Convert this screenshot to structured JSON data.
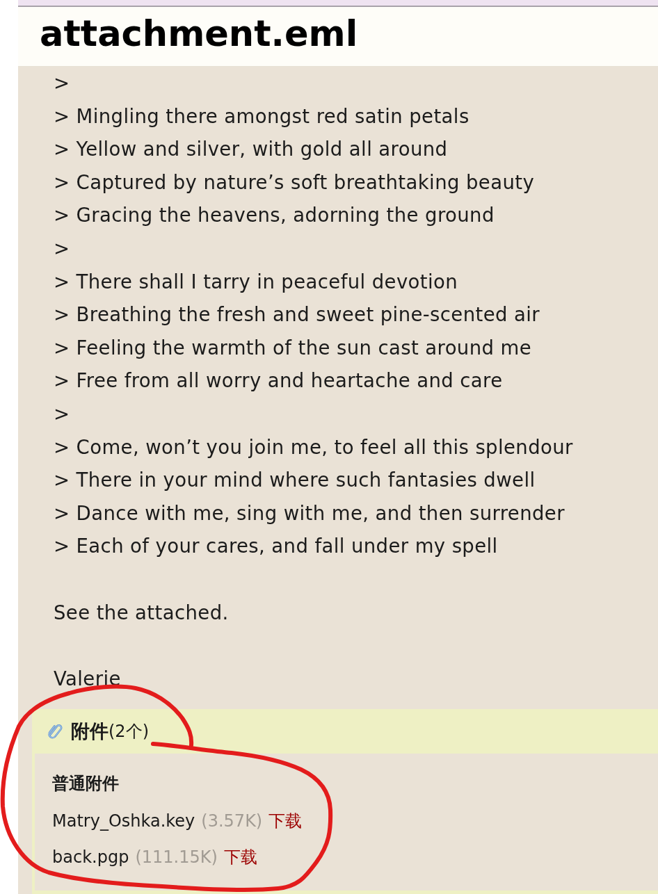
{
  "title": "attachment.eml",
  "message": {
    "quote_lines": [
      ">",
      "> Mingling there amongst red satin petals",
      "> Yellow and silver, with gold all around",
      "> Captured by nature’s soft breathtaking beauty",
      "> Gracing the heavens, adorning the ground",
      ">",
      "> There shall I tarry in peaceful devotion",
      "> Breathing the fresh and sweet pine-scented air",
      "> Feeling the warmth of the sun cast around me",
      "> Free from all worry and heartache and care",
      ">",
      "> Come, won’t you join me, to feel all this splendour",
      "> There in your mind where such fantasies dwell",
      "> Dance with me, sing with me, and then surrender",
      "> Each of your cares, and fall under my spell"
    ],
    "paragraphs": [
      "See the attached.",
      "Valerie"
    ]
  },
  "attachments": {
    "heading": "附件",
    "count": "(2个)",
    "group_label": "普通附件",
    "files": [
      {
        "name": "Matry_Oshka.key",
        "size": "(3.57K)",
        "action": "下载"
      },
      {
        "name": "back.pgp",
        "size": "(111.15K)",
        "action": "下载"
      }
    ]
  }
}
